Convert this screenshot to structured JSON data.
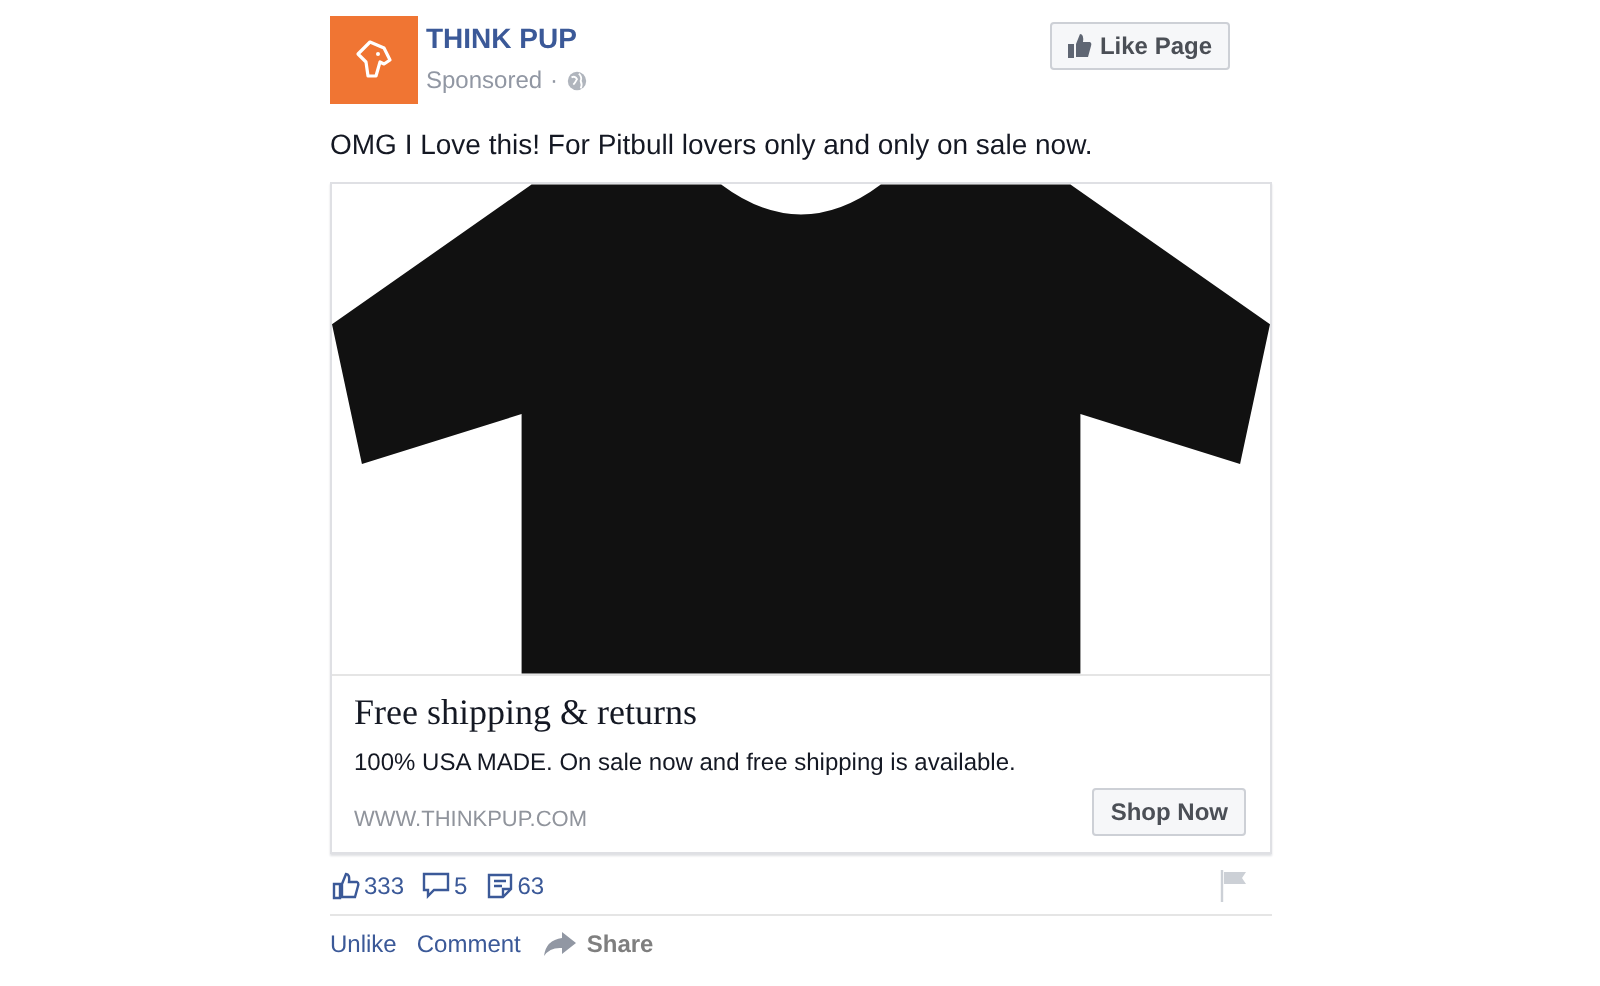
{
  "post": {
    "page_name": "THINK PUP",
    "sponsored": "Sponsored",
    "separator": "·",
    "message": "OMG I Love this! For Pitbull lovers only and only on sale now."
  },
  "like_page_button": "Like Page",
  "ad": {
    "headline": "Free shipping & returns",
    "description": "100% USA MADE. On sale now and free shipping is available.",
    "link": "WWW.THINKPUP.COM",
    "cta": "Shop Now"
  },
  "stats": [
    {
      "kind": "likes",
      "count": "333"
    },
    {
      "kind": "comments",
      "count": "5"
    },
    {
      "kind": "shares",
      "count": "63"
    }
  ],
  "actions": [
    {
      "kind": "unlike",
      "label": "Unlike"
    },
    {
      "kind": "comment",
      "label": "Comment"
    },
    {
      "kind": "share",
      "label": "Share"
    }
  ]
}
